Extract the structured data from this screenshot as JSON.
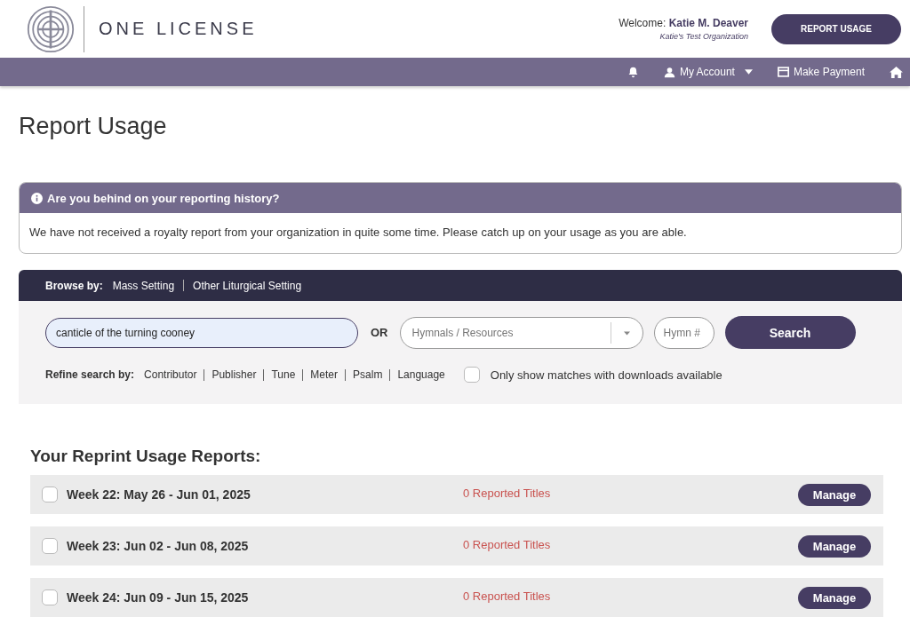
{
  "header": {
    "logo_text": "ONE LICENSE",
    "welcome_label": "Welcome:",
    "user_name": "Katie M. Deaver",
    "organization": "Katie's Test Organization",
    "report_button": "REPORT USAGE"
  },
  "nav": {
    "items": [
      {
        "kind": "bell"
      },
      {
        "kind": "account",
        "label": "My Account"
      },
      {
        "kind": "payment",
        "label": "Make Payment"
      },
      {
        "kind": "home"
      }
    ]
  },
  "page_title": "Report Usage",
  "alert": {
    "title": "Are you behind on your reporting history?",
    "message": "We have not received a royalty report from your organization in quite some time. Please catch up on your usage as you are able."
  },
  "browse": {
    "label": "Browse by:",
    "links": [
      "Mass Setting",
      "Other Liturgical Setting"
    ]
  },
  "search": {
    "query": "canticle of the turning cooney",
    "or_label": "OR",
    "resources_placeholder": "Hymnals / Resources",
    "hymn_placeholder": "Hymn #",
    "button": "Search"
  },
  "refine": {
    "label": "Refine search by:",
    "links": [
      "Contributor",
      "Publisher",
      "Tune",
      "Meter",
      "Psalm",
      "Language"
    ],
    "downloads_only": {
      "label": "Only show matches with downloads available",
      "checked": false
    }
  },
  "reports": {
    "title": "Your Reprint Usage Reports:",
    "rows": [
      {
        "week": "Week 22: May 26 - Jun 01, 2025",
        "reported": "0 Reported Titles",
        "checked": false,
        "button": "Manage"
      },
      {
        "week": "Week 23: Jun 02 - Jun 08, 2025",
        "reported": "0 Reported Titles",
        "checked": false,
        "button": "Manage"
      },
      {
        "week": "Week 24: Jun 09 - Jun 15, 2025",
        "reported": "0 Reported Titles",
        "checked": false,
        "button": "Manage"
      }
    ]
  }
}
